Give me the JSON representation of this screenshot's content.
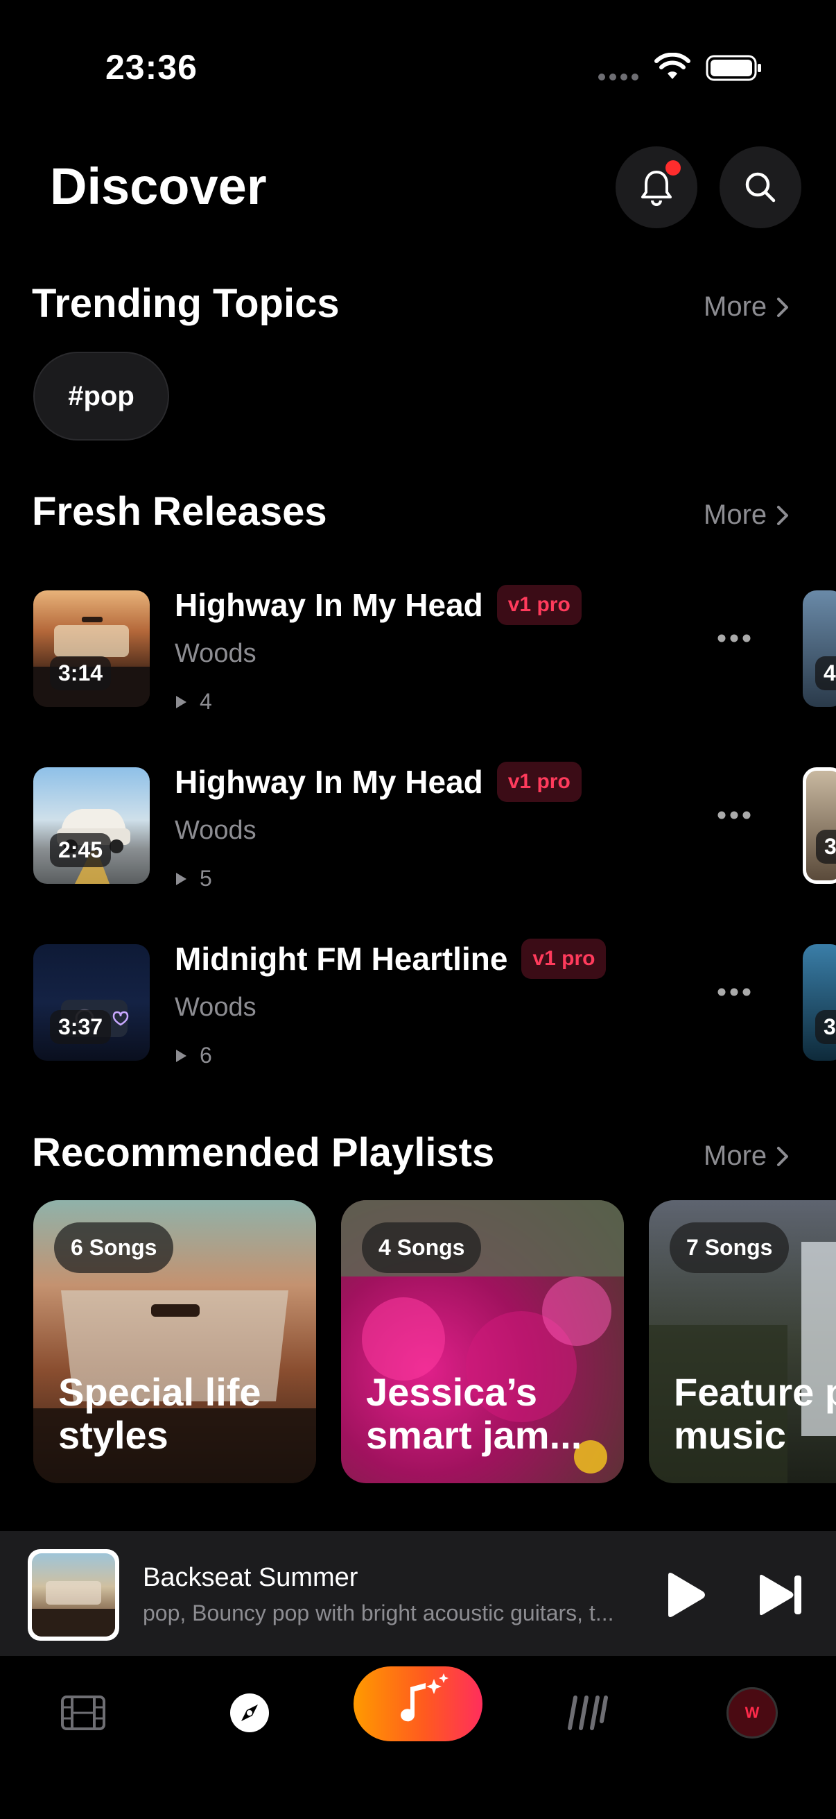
{
  "status_bar": {
    "time": "23:36"
  },
  "header": {
    "title": "Discover"
  },
  "trending": {
    "title": "Trending Topics",
    "more": "More",
    "chips": [
      "#pop"
    ]
  },
  "fresh": {
    "title": "Fresh Releases",
    "more": "More",
    "songs": [
      {
        "title": "Highway In My Head",
        "badge": "v1 pro",
        "artist": "Woods",
        "plays": "4",
        "duration": "3:14"
      },
      {
        "title": "Highway In My Head",
        "badge": "v1 pro",
        "artist": "Woods",
        "plays": "5",
        "duration": "2:45"
      },
      {
        "title": "Midnight FM Heartline",
        "badge": "v1 pro",
        "artist": "Woods",
        "plays": "6",
        "duration": "3:37"
      }
    ],
    "peek_durations": [
      "4:",
      "3:",
      "3:"
    ]
  },
  "playlists": {
    "title": "Recommended Playlists",
    "more": "More",
    "items": [
      {
        "count": "6 Songs",
        "line1": "Special life",
        "line2": "styles"
      },
      {
        "count": "4 Songs",
        "line1": "Jessica’s",
        "line2": "smart jam..."
      },
      {
        "count": "7 Songs",
        "line1": "Feature p",
        "line2": "music"
      }
    ]
  },
  "player": {
    "title": "Backseat Summer",
    "subtitle": "pop, Bouncy pop with bright acoustic guitars, t..."
  },
  "tabbar": {
    "avatar_letter": "W",
    "accent_gradient": [
      "#ff9a00",
      "#ff2e5c"
    ]
  },
  "colors": {
    "badge_text": "#ff3b5c",
    "badge_bg": "#3b0c16",
    "notification_dot": "#ff2d2d",
    "muted_text": "#8d8d92"
  }
}
